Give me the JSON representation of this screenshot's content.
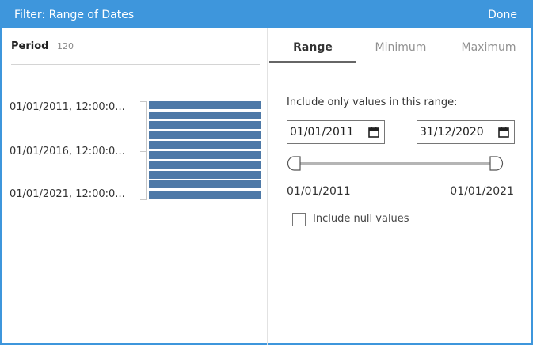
{
  "dialog": {
    "title": "Filter: Range of Dates",
    "done_label": "Done"
  },
  "field": {
    "name": "Period",
    "count": "120",
    "axis_labels": [
      "01/01/2011, 12:00:0...",
      "01/01/2016, 12:00:0...",
      "01/01/2021, 12:00:0..."
    ],
    "bar_color": "#4e79a7",
    "bar_count": 10
  },
  "tabs": [
    {
      "label": "Range",
      "active": true
    },
    {
      "label": "Minimum",
      "active": false
    },
    {
      "label": "Maximum",
      "active": false
    }
  ],
  "range": {
    "prompt": "Include only values in this range:",
    "start_value": "01/01/2011",
    "end_value": "31/12/2020",
    "slider_min": "01/01/2011",
    "slider_max": "01/01/2021",
    "include_null_label": "Include null values",
    "include_null_checked": false
  },
  "colors": {
    "accent": "#3e96dc",
    "bar": "#4e79a7"
  }
}
